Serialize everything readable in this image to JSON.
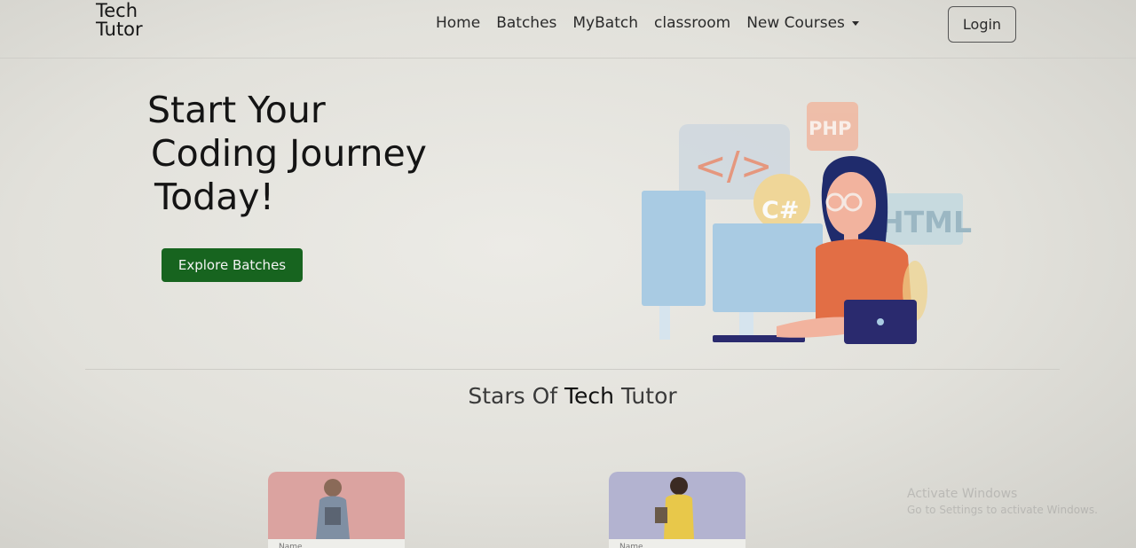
{
  "navbar": {
    "brand_line1": "Tech",
    "brand_line2": "Tutor",
    "links": [
      "Home",
      "Batches",
      "MyBatch",
      "classroom",
      "New Courses"
    ],
    "login_label": "Login"
  },
  "hero": {
    "title_line1": "Start Your",
    "title_line2": "Coding Journey",
    "title_line3": "Today!",
    "explore_label": "Explore Batches",
    "illustration_tags": [
      "</>",
      "PHP",
      "C#",
      "HTML"
    ]
  },
  "section": {
    "title_pre": "Stars Of ",
    "title_strong": "Tech",
    "title_post": " Tutor"
  },
  "cards": [
    {
      "name_label": "Name"
    },
    {
      "name_label": "Name"
    }
  ],
  "watermark": {
    "line1": "Activate Windows",
    "line2": "Go to Settings to activate Windows."
  },
  "colors": {
    "primary_button": "#17641f",
    "illustration_blue": "#a9cbe3",
    "illustration_orange": "#e26e45",
    "illustration_navy": "#2a2a6e"
  }
}
